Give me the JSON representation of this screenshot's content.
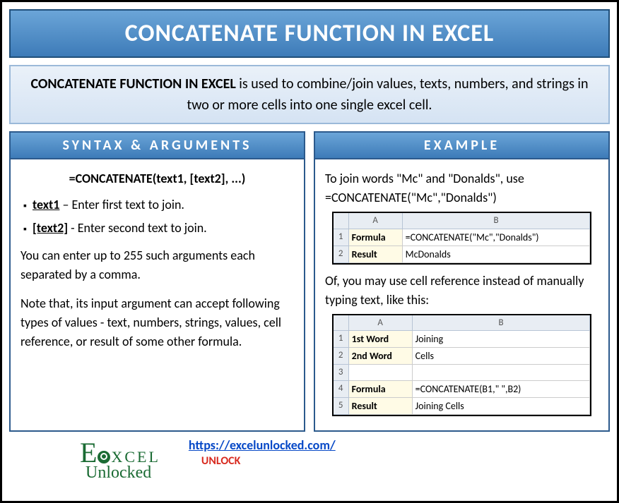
{
  "title": "CONCATENATE FUNCTION IN EXCEL",
  "description": {
    "lead": "CONCATENATE FUNCTION IN EXCEL",
    "rest": " is used to combine/join values, texts, numbers, and strings in two or more cells into one single excel cell."
  },
  "syntax": {
    "header": "SYNTAX & ARGUMENTS",
    "formula": "=CONCATENATE(text1, [text2], ...)",
    "args": [
      {
        "name": "text1",
        "desc": " – Enter first text to join."
      },
      {
        "name": "[text2]",
        "desc": " - Enter second text to join."
      }
    ],
    "para1": "You can enter up to 255 such arguments each separated by a comma.",
    "para2": "Note that, its input argument can accept following types of values - text, numbers, strings, values, cell reference, or result of some other formula."
  },
  "example": {
    "header": "EXAMPLE",
    "intro1": "To join words \"Mc\" and \"Donalds\", use",
    "intro2": "=CONCATENATE(\"Mc\",\"Donalds\")",
    "table1": {
      "colA": "A",
      "colB": "B",
      "rows": [
        {
          "n": "1",
          "a": "Formula",
          "b": "=CONCATENATE(\"Mc\",\"Donalds\")"
        },
        {
          "n": "2",
          "a": "Result",
          "b": "McDonalds"
        }
      ]
    },
    "mid": "Of, you may use cell reference instead of manually typing text, like this:",
    "table2": {
      "colA": "A",
      "colB": "B",
      "rows": [
        {
          "n": "1",
          "a": "1st Word",
          "b": "Joining",
          "alabel": true
        },
        {
          "n": "2",
          "a": "2nd Word",
          "b": "Cells",
          "alabel": true
        },
        {
          "n": "3",
          "a": "",
          "b": ""
        },
        {
          "n": "4",
          "a": "Formula",
          "b": "=CONCATENATE(B1,\" \",B2)",
          "alabel": true
        },
        {
          "n": "5",
          "a": "Result",
          "b": "Joining Cells",
          "alabel": true
        }
      ]
    }
  },
  "footer": {
    "logo_top_e": "E",
    "logo_top_rest": "XCEL",
    "logo_bottom": "Unlocked",
    "link": "https://excelunlocked.com/",
    "unlock": "UNLOCK"
  }
}
